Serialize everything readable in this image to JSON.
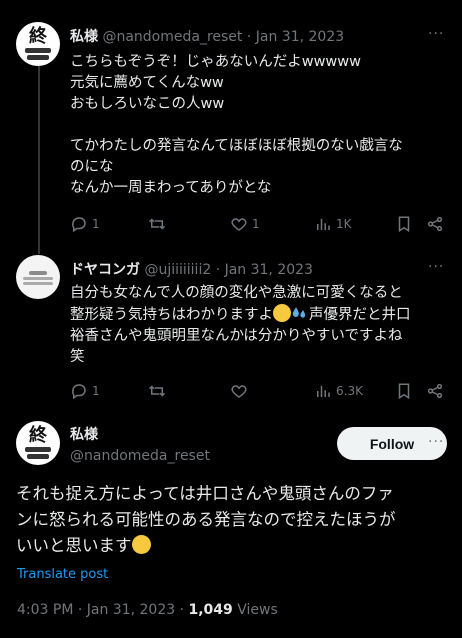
{
  "tweet1": {
    "name": "私様",
    "handle": "@nandomeda_reset",
    "date": "· Jan 31, 2023",
    "avatar_text": "終",
    "lines": [
      "こちらもぞうぞ！じゃあないんだよwwwww",
      "元気に薦めてくんなww",
      "おもしろいなこの人ww",
      "",
      "てかわたしの発言なんてほぼほぼ根拠のない戯言な",
      "のにな",
      "なんか一周まわってありがとな"
    ],
    "replies": "1",
    "retweets": "",
    "likes": "1",
    "views": "1K"
  },
  "tweet2": {
    "name": "ドヤコンガ",
    "handle": "@ujiiiiiiii2 · Jan 31, 2023",
    "lines": [
      "自分も女なんで人の顔の変化や急激に可愛くなると",
      "整形疑う気持ちはわかりますよ",
      "声優界だと井口",
      "裕香さんや鬼頭明里なんかは分かりやすいですよね",
      "笑"
    ],
    "replies": "1",
    "views": "6.3K"
  },
  "main": {
    "name": "私様",
    "handle": "@nandomeda_reset",
    "follow_label": "Follow",
    "lines": [
      "それも捉え方によっては井口さんや鬼頭さんのファ",
      "ンに怒られる可能性のある発言なので控えたほうが",
      "いいと思います"
    ],
    "translate": "Translate post",
    "time": "4:03 PM · Jan 31, 2023 · ",
    "views_count": "1,049",
    "views_label": " Views"
  },
  "more_icon": "more-dots-icon",
  "colors": {
    "accent": "#1d9bf0",
    "muted": "#71767b",
    "text": "#e7e9ea",
    "bg": "#000000"
  }
}
